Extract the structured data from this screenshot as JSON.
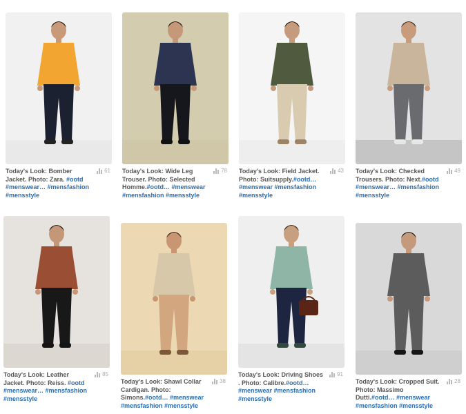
{
  "posts": [
    {
      "caption": "Today's Look: Bomber Jacket. Photo: Zara. ",
      "tags": "#ootd #menswear… #mensfashion #mensstyle",
      "count": "61",
      "bg": "#f1f1f1",
      "floor": "#e9e9e9",
      "top": "#f3a531",
      "bottom": "#1b2130",
      "shoe": "#222222",
      "skin": "#c89a79",
      "hair": "#2c1d14"
    },
    {
      "caption": "Today's Look: Wide Leg Trouser. Photo: Selected Homme.",
      "tags": "#ootd… #menswear #mensfashion #mensstyle",
      "count": "78",
      "bg": "#d3ccaf",
      "floor": "#cfc7a8",
      "top": "#2c3452",
      "bottom": "#15171c",
      "shoe": "#111111",
      "skin": "#c59879",
      "hair": "#2a1a10"
    },
    {
      "caption": "Today's Look: Field Jacket. Photo: Suitsupply.",
      "tags": "#ootd… #menswear #mensfashion #mensstyle",
      "count": "43",
      "bg": "#f5f5f5",
      "floor": "#eeeeee",
      "top": "#4f5a3e",
      "bottom": "#d8cbb0",
      "shoe": "#9a8367",
      "skin": "#c69a7c",
      "hair": "#2b1d13"
    },
    {
      "caption": "Today's Look: Checked Trousers. Photo: Next.",
      "tags": "#ootd #menswear… #mensfashion #mensstyle",
      "count": "49",
      "bg": "#e3e3e3",
      "floor": "#c5c5c5",
      "top": "#c9b59b",
      "bottom": "#6a6b6e",
      "shoe": "#e8e8e8",
      "skin": "#c79b7c",
      "hair": "#3a2a1c"
    },
    {
      "caption": "Today's Look: Leather Jacket. Photo: Reiss. ",
      "tags": "#ootd #menswear… #mensfashion #mensstyle",
      "count": "85",
      "bg": "#e6e3de",
      "floor": "#dcd7d0",
      "top": "#9a4f34",
      "bottom": "#181818",
      "shoe": "#141414",
      "skin": "#c49778",
      "hair": "#261a11"
    },
    {
      "caption": "Today's Look: Shawl Collar Cardigan. Photo: Simons.",
      "tags": "#ootd… #menswear #mensfashion #mensstyle",
      "count": "38",
      "bg": "#ecd9b4",
      "floor": "#e6d0a6",
      "top": "#d8c8aa",
      "bottom": "#d2a67e",
      "shoe": "#7d5838",
      "skin": "#c99674",
      "hair": "#3a2414"
    },
    {
      "caption": "Today's Look: Driving Shoes . Photo: Calibre.",
      "tags": "#ootd… #menswear #mensfashion #mensstyle",
      "count": "91",
      "bg": "#efefef",
      "floor": "#e4e4e4",
      "top": "#8fb5a7",
      "bottom": "#1d2540",
      "shoe": "#2f4a3d",
      "skin": "#c9a07f",
      "hair": "#3a2a1c",
      "bag": "#5a2416"
    },
    {
      "caption": "Today's Look: Cropped Suit. Photo: Massimo Dutti.",
      "tags": "#ootd… #menswear #mensfashion #mensstyle",
      "count": "28",
      "bg": "#d9d9d9",
      "floor": "#cfcfcf",
      "top": "#5c5c5c",
      "bottom": "#5c5c5c",
      "shoe": "#161616",
      "skin": "#c59a7c",
      "hair": "#1f1a16"
    }
  ]
}
